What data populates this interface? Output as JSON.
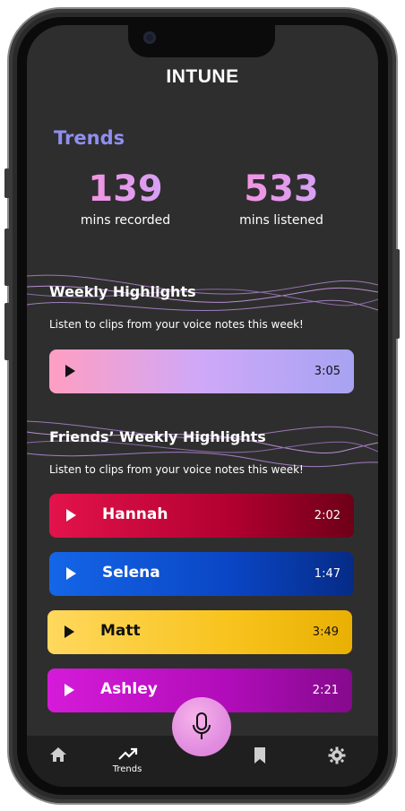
{
  "app": {
    "title": "INTUNE"
  },
  "trends": {
    "heading": "Trends",
    "stats": [
      {
        "value": "139",
        "label": "mins recorded"
      },
      {
        "value": "533",
        "label": "mins listened"
      }
    ]
  },
  "weekly": {
    "heading": "Weekly Highlights",
    "subtitle": "Listen to clips from your voice notes this week!",
    "clip": {
      "duration": "3:05"
    }
  },
  "friends": {
    "heading": "Friends’ Weekly Highlights",
    "subtitle": "Listen to clips from your voice notes this week!",
    "items": [
      {
        "name": "Hannah",
        "duration": "2:02"
      },
      {
        "name": "Selena",
        "duration": "1:47"
      },
      {
        "name": "Matt",
        "duration": "3:49"
      },
      {
        "name": "Ashley",
        "duration": "2:21"
      }
    ]
  },
  "tabbar": {
    "tabs": [
      {
        "icon": "home-icon",
        "label": ""
      },
      {
        "icon": "trending-icon",
        "label": "Trends"
      },
      {
        "icon": "bookmark-icon",
        "label": ""
      },
      {
        "icon": "gear-icon",
        "label": ""
      }
    ],
    "record": {
      "icon": "microphone-icon"
    }
  }
}
